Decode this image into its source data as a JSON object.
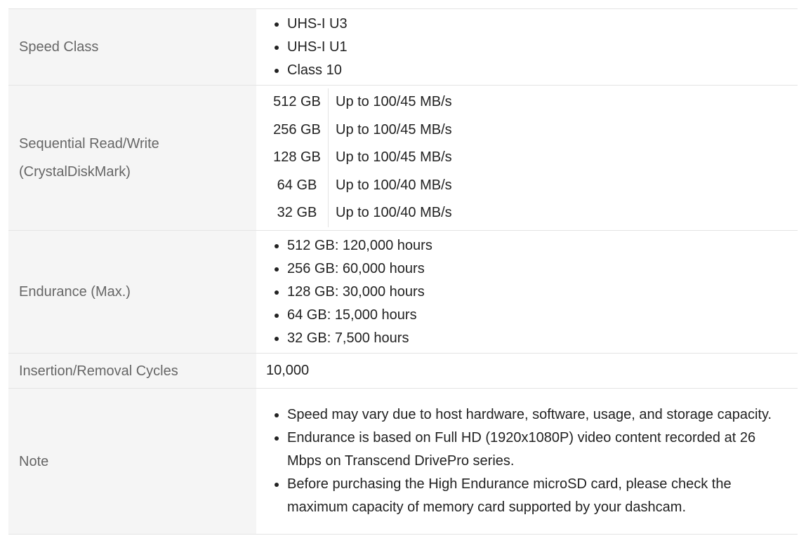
{
  "rows": {
    "speed_class": {
      "label": "Speed Class",
      "items": [
        "UHS-I U3",
        "UHS-I U1",
        "Class 10"
      ]
    },
    "sequential": {
      "label_line1": "Sequential Read/Write",
      "label_line2": "(CrystalDiskMark)",
      "entries": [
        {
          "capacity": "512 GB",
          "speed": "Up to 100/45 MB/s"
        },
        {
          "capacity": "256 GB",
          "speed": "Up to 100/45 MB/s"
        },
        {
          "capacity": "128 GB",
          "speed": "Up to 100/45 MB/s"
        },
        {
          "capacity": "64 GB",
          "speed": "Up to 100/40 MB/s"
        },
        {
          "capacity": "32 GB",
          "speed": "Up to 100/40 MB/s"
        }
      ]
    },
    "endurance": {
      "label": "Endurance (Max.)",
      "items": [
        "512 GB: 120,000 hours",
        "256 GB: 60,000 hours",
        "128 GB: 30,000 hours",
        "64 GB: 15,000 hours",
        "32 GB: 7,500 hours"
      ]
    },
    "insertion": {
      "label": "Insertion/Removal Cycles",
      "value": "10,000"
    },
    "note": {
      "label": "Note",
      "items": [
        "Speed may vary due to host hardware, software, usage, and storage capacity.",
        "Endurance is based on Full HD (1920x1080P) video content recorded at 26 Mbps on Transcend DrivePro series.",
        "Before purchasing the High Endurance microSD card, please check the maximum capacity of memory card supported by your dashcam."
      ]
    }
  }
}
